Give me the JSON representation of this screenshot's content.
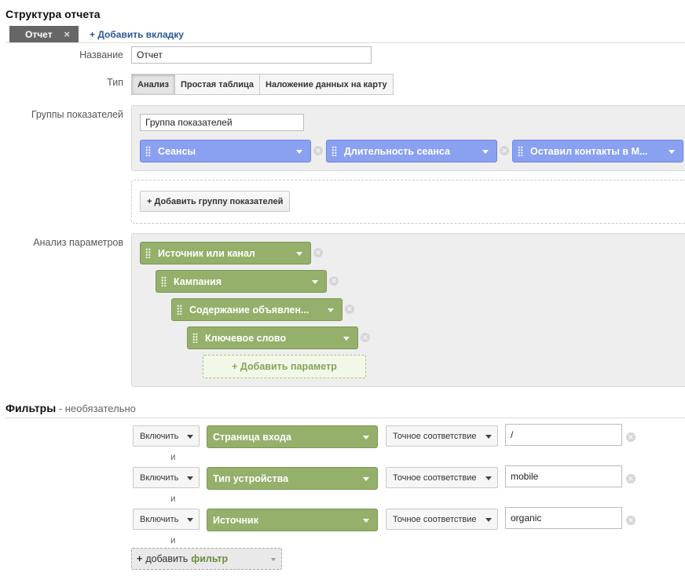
{
  "header": {
    "title": "Структура отчета"
  },
  "tabs": {
    "active_label": "Отчет",
    "close_glyph": "×",
    "add_tab_label": "+ Добавить вкладку"
  },
  "name": {
    "label": "Название",
    "value": "Отчет"
  },
  "type": {
    "label": "Тип",
    "options": [
      "Анализ",
      "Простая таблица",
      "Наложение данных на карту"
    ],
    "selected": "Анализ"
  },
  "metric_groups": {
    "label": "Группы показателей",
    "group_name": "Группа показателей",
    "metrics": [
      "Сеансы",
      "Длительность сеанса",
      "Оставил контакты в М..."
    ],
    "add_group_label": "+ Добавить группу показателей"
  },
  "dimensions": {
    "label": "Анализ параметров",
    "items": [
      "Источник или канал",
      "Кампания",
      "Содержание объявлен...",
      "Ключевое слово"
    ],
    "add_label": "+ Добавить параметр"
  },
  "filters": {
    "title": "Фильтры",
    "subtitle": " - необязательно",
    "and_label": "и",
    "rows": [
      {
        "include": "Включить",
        "dimension": "Страница входа",
        "match": "Точное соответствие",
        "value": "/"
      },
      {
        "include": "Включить",
        "dimension": "Тип устройства",
        "match": "Точное соответствие",
        "value": "mobile"
      },
      {
        "include": "Включить",
        "dimension": "Источник",
        "match": "Точное соответствие",
        "value": "organic"
      }
    ],
    "add_filter": {
      "prefix": "+",
      "text": "добавить",
      "highlight": "фильтр"
    }
  },
  "colors": {
    "metric_chip": "#8aa1f2",
    "dimension_chip": "#94b06a",
    "tab_active": "#666666",
    "link": "#2b5797"
  },
  "icons": {
    "remove": "remove-circle-icon",
    "dropdown": "chevron-down-icon",
    "drag": "drag-handle-icon"
  }
}
